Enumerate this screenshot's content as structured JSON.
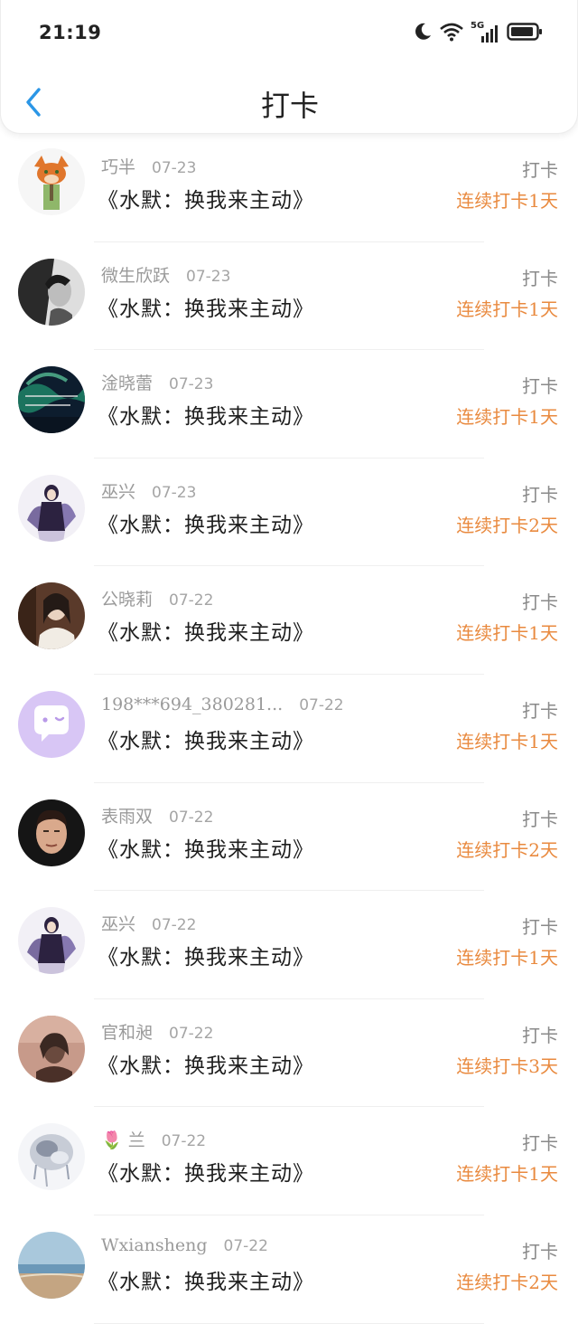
{
  "status_bar": {
    "time": "21:19",
    "network": "5G"
  },
  "nav": {
    "title": "打卡"
  },
  "colors": {
    "accent_back": "#2b96e6",
    "streak": "#e98a3f",
    "meta": "#9a9a9a"
  },
  "entries": [
    {
      "name": "巧半",
      "date": "07-23",
      "book": "《水默：换我来主动》",
      "action": "打卡",
      "streak": "连续打卡1天",
      "avatar": "fox-cartoon-avatar"
    },
    {
      "name": "微生欣跃",
      "date": "07-23",
      "book": "《水默：换我来主动》",
      "action": "打卡",
      "streak": "连续打卡1天",
      "avatar": "woman-bw-avatar"
    },
    {
      "name": "淦晓蕾",
      "date": "07-23",
      "book": "《水默：换我来主动》",
      "action": "打卡",
      "streak": "连续打卡1天",
      "avatar": "aurora-text-avatar"
    },
    {
      "name": "巫兴",
      "date": "07-23",
      "book": "《水默：换我来主动》",
      "action": "打卡",
      "streak": "连续打卡2天",
      "avatar": "anime-figure-avatar"
    },
    {
      "name": "公晓莉",
      "date": "07-22",
      "book": "《水默：换我来主动》",
      "action": "打卡",
      "streak": "连续打卡1天",
      "avatar": "woman-portrait-avatar"
    },
    {
      "name": "198***694_380281...",
      "date": "07-22",
      "book": "《水默：换我来主动》",
      "action": "打卡",
      "streak": "连续打卡1天",
      "avatar": "default-chat-avatar"
    },
    {
      "name": "表雨双",
      "date": "07-22",
      "book": "《水默：换我来主动》",
      "action": "打卡",
      "streak": "连续打卡2天",
      "avatar": "man-portrait-avatar"
    },
    {
      "name": "巫兴",
      "date": "07-22",
      "book": "《水默：换我来主动》",
      "action": "打卡",
      "streak": "连续打卡1天",
      "avatar": "anime-figure-avatar"
    },
    {
      "name": "官和昶",
      "date": "07-22",
      "book": "《水默：换我来主动》",
      "action": "打卡",
      "streak": "连续打卡3天",
      "avatar": "sunset-portrait-avatar"
    },
    {
      "name": "🌷 兰",
      "date": "07-22",
      "book": "《水默：换我来主动》",
      "action": "打卡",
      "streak": "连续打卡1天",
      "avatar": "silver-art-avatar"
    },
    {
      "name": "Wxiansheng",
      "date": "07-22",
      "book": "《水默：换我来主动》",
      "action": "打卡",
      "streak": "连续打卡2天",
      "avatar": "beach-avatar"
    }
  ]
}
